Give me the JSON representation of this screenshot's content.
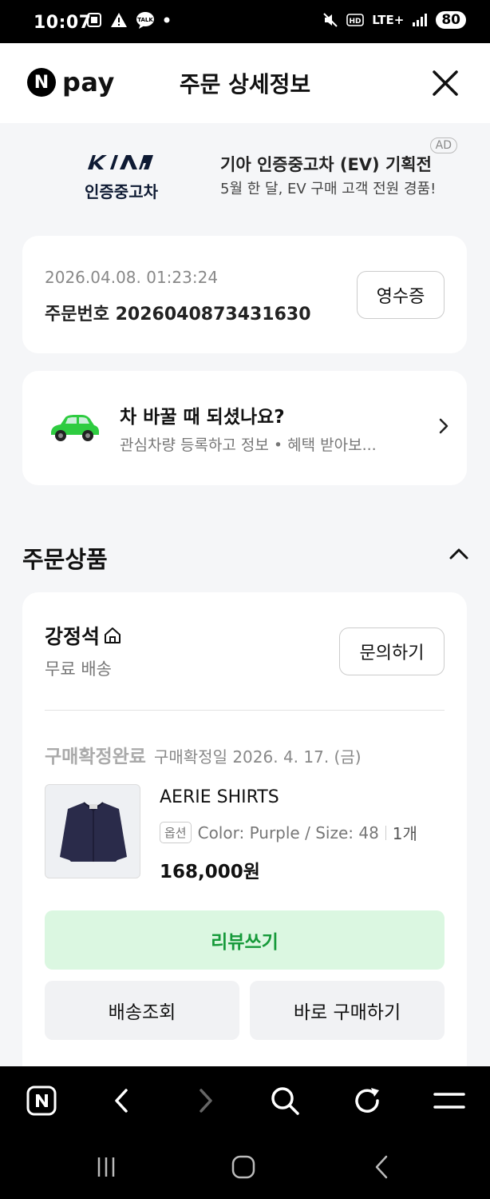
{
  "status_bar": {
    "time": "10:07",
    "left_icons": [
      "screenshot-icon",
      "warning-icon",
      "talk-icon",
      "dot-icon"
    ],
    "network": "LTE+",
    "battery": "80"
  },
  "header": {
    "brand": "pay",
    "brand_letter": "N",
    "title": "주문 상세정보"
  },
  "ad": {
    "badge": "AD",
    "brand_sub": "인증중고차",
    "title": "기아 인증중고차 (EV) 기획전",
    "subtitle": "5월 한 달, EV 구매 고객 전원 경품!"
  },
  "order": {
    "date": "2026.04.08. 01:23:24",
    "number_label": "주문번호 2026040873431630",
    "receipt_button": "영수증"
  },
  "car_banner": {
    "title": "차 바꿀 때 되셨나요?",
    "subtitle": "관심차량 등록하고 정보 • 혜택 받아보..."
  },
  "section": {
    "title": "주문상품"
  },
  "product": {
    "seller": "강정석",
    "shipping": "무료 배송",
    "inquiry_button": "문의하기",
    "status": "구매확정완료",
    "status_date": "구매확정일 2026. 4. 17. (금)",
    "name": "AERIE SHIRTS",
    "option_tag": "옵션",
    "option": "Color: Purple / Size: 48",
    "quantity": "1개",
    "price": "168,000원",
    "review_button": "리뷰쓰기",
    "tracking_button": "배송조회",
    "buy_again_button": "바로 구매하기"
  },
  "colors": {
    "accent_green": "#169a3a",
    "review_bg": "#dbf7e1",
    "car_green": "#2ecc40"
  },
  "browser_bar": {
    "icons": [
      "naver-home-icon",
      "back-icon",
      "forward-icon",
      "search-icon",
      "refresh-icon",
      "menu-icon"
    ]
  },
  "nav_bar": {
    "icons": [
      "recents-icon",
      "home-icon",
      "back-icon"
    ]
  }
}
